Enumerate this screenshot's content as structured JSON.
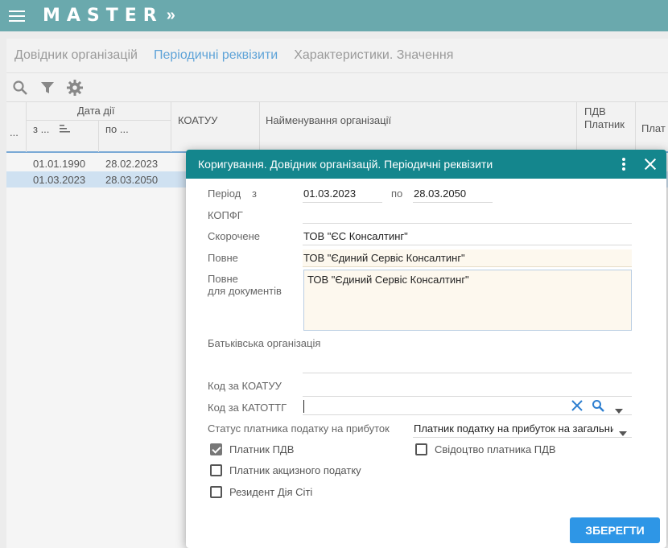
{
  "app": {
    "brand": "MASTER",
    "brand_arrow": "»"
  },
  "tabs": [
    {
      "label": "Довідник організацій"
    },
    {
      "label": "Періодичні реквізити",
      "active": true
    },
    {
      "label": "Характеристики. Значення"
    }
  ],
  "grid": {
    "headers": {
      "dots": "...",
      "date_group": "Дата дії",
      "date_from": "з ...",
      "date_to": "по ...",
      "koatuu": "КОАТУУ",
      "org_name": "Найменування організації",
      "pdv_line1": "ПДВ",
      "pdv_line2": "Платник",
      "plat": "Плат"
    },
    "rows": [
      {
        "from": "01.01.1990",
        "to": "28.02.2023"
      },
      {
        "from": "01.03.2023",
        "to": "28.03.2050"
      }
    ]
  },
  "modal": {
    "title": "Коригування. Довідник організацій. Періодичні реквізити",
    "period_label": "Період",
    "from_label": "з",
    "from_value": "01.03.2023",
    "to_label": "по",
    "to_value": "28.03.2050",
    "kopfg_label": "КОПФГ",
    "kopfg_value": "",
    "short_label": "Скорочене",
    "short_value": "ТОВ \"ЄС Консалтинг\"",
    "full_label": "Повне",
    "full_value": "ТОВ \"Єдиний Сервіс Консалтинг\"",
    "docs_label_1": "Повне",
    "docs_label_2": "для документів",
    "docs_value": "ТОВ \"Єдиний Сервіс Консалтинг\"",
    "parent_label": "Батьківська організація",
    "koatuu_label": "Код за КОАТУУ",
    "katottg_label": "Код за КАТОТТГ",
    "tax_status_label": "Статус платника податку на прибуток",
    "tax_status_value": "Платник податку на прибуток на загальних",
    "checkboxes": [
      {
        "label": "Платник ПДВ",
        "checked": true
      },
      {
        "label": "Свідоцтво платника ПДВ",
        "checked": false
      },
      {
        "label": "Платник акцизного податку",
        "checked": false
      },
      {
        "label": "Резидент Дія Сіті",
        "checked": false
      }
    ],
    "save_label": "ЗБЕРЕГТИ"
  }
}
